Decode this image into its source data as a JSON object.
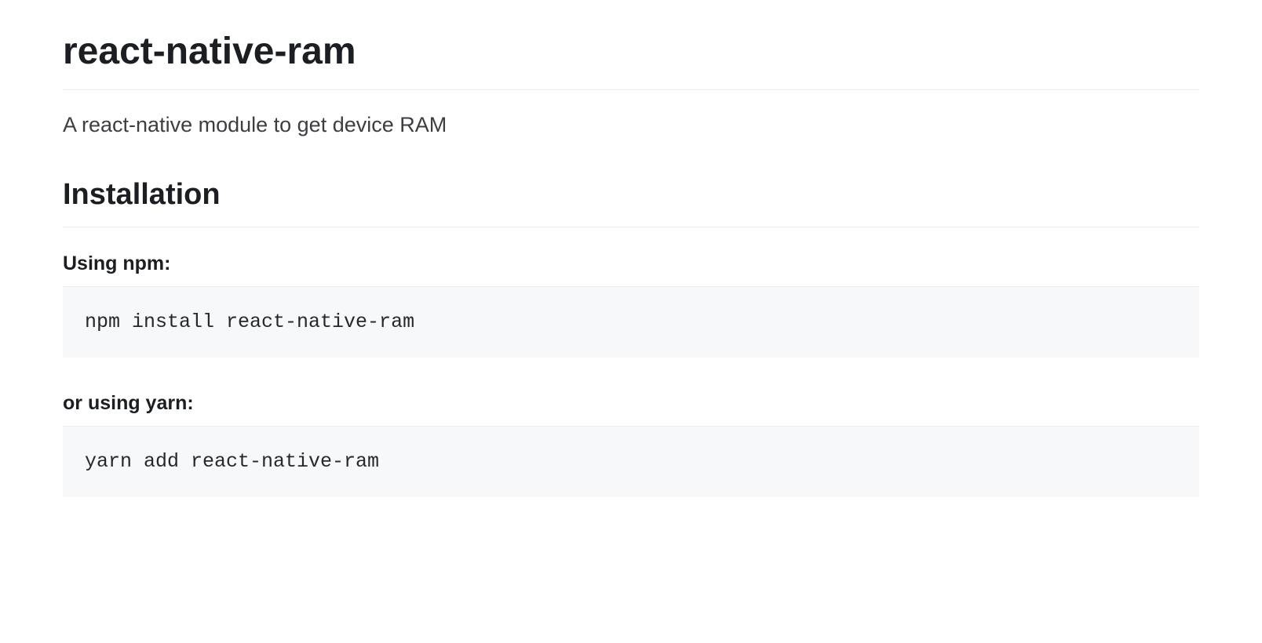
{
  "title": "react-native-ram",
  "description": "A react-native module to get device RAM",
  "sections": {
    "installation": {
      "heading": "Installation",
      "npm": {
        "label": "Using npm:",
        "code": "npm install react-native-ram"
      },
      "yarn": {
        "label": "or using yarn:",
        "code": "yarn add react-native-ram"
      }
    }
  }
}
